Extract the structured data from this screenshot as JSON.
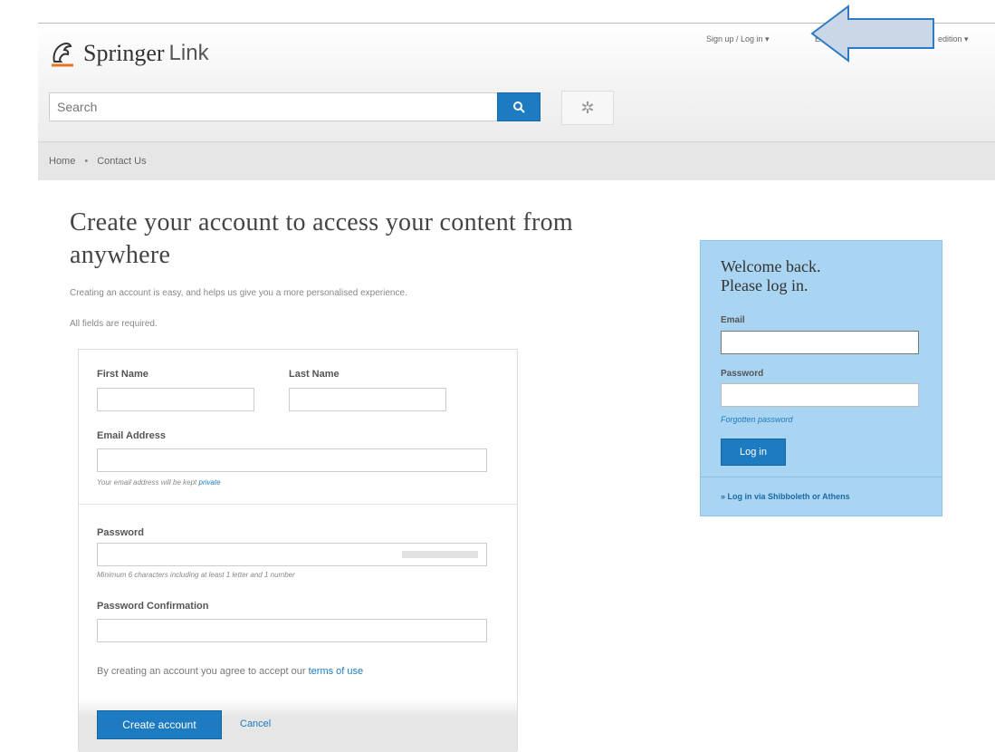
{
  "header": {
    "brand_bold": "Springer",
    "brand_light": "Link",
    "search_placeholder": "Search",
    "toplink_signup": "Sign up / Log in  ▾",
    "toplink_edition": "edition  ▾",
    "toplink_middle": "E"
  },
  "breadcrumb": {
    "home": "Home",
    "sep": "•",
    "contact": "Contact Us"
  },
  "main": {
    "title": "Create your account to access your content from anywhere",
    "intro": "Creating an account is easy, and helps us give you a more personalised experience.",
    "required_note": "All fields are required.",
    "form": {
      "first_name_label": "First Name",
      "last_name_label": "Last Name",
      "email_label": "Email Address",
      "email_hint": "Your email address will be kept",
      "email_hint_link": "private",
      "password_label": "Password",
      "password_hint": "Minimum 6 characters including at least 1 letter and 1 number",
      "password_confirm_label": "Password Confirmation",
      "terms_text": "By creating an account you agree to accept our",
      "terms_link": "terms of use",
      "create_button": "Create account",
      "cancel_link": "Cancel"
    }
  },
  "login": {
    "heading_line1": "Welcome back.",
    "heading_line2": "Please log in.",
    "email_label": "Email",
    "password_label": "Password",
    "forgot_link": "Forgotten password",
    "login_button": "Log in",
    "shibboleth_link": "» Log in via Shibboleth or Athens"
  },
  "colors": {
    "accent": "#1d7bc2",
    "login_panel": "#a9d4f2",
    "annotation_arrow": "#c9d7e6"
  }
}
